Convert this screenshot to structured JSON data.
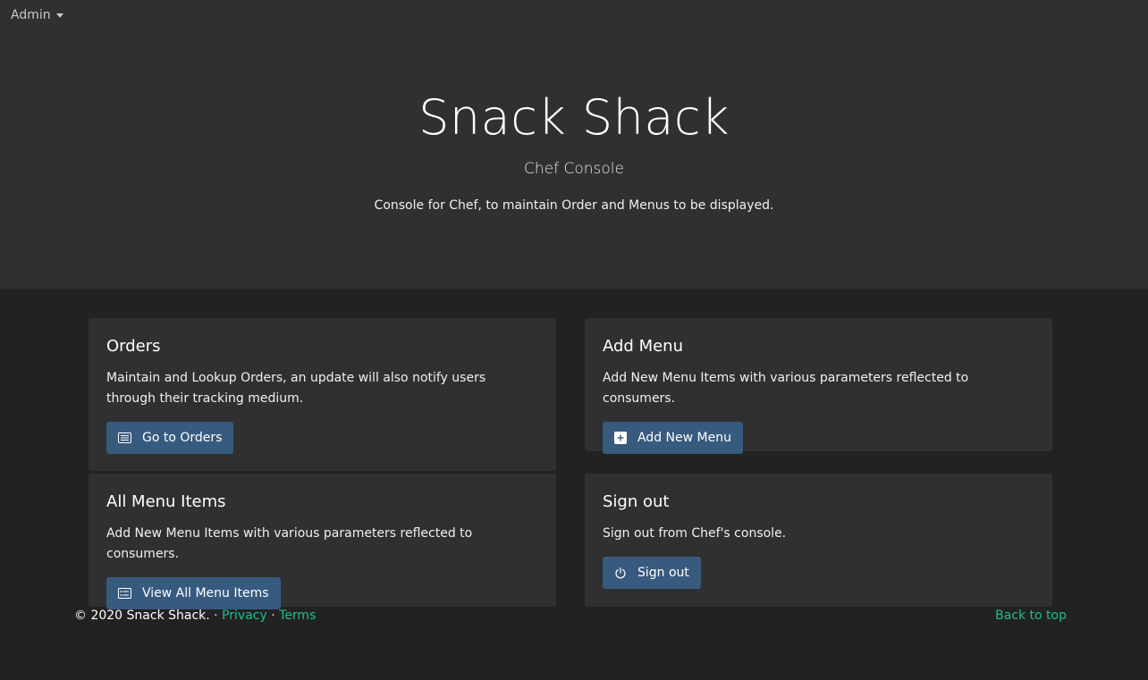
{
  "nav": {
    "admin_label": "Admin"
  },
  "hero": {
    "title": "Snack Shack",
    "subtitle": "Chef Console",
    "description": "Console for Chef, to maintain Order and Menus to be displayed."
  },
  "cards": {
    "orders": {
      "title": "Orders",
      "text": "Maintain and Lookup Orders, an update will also notify users through their tracking medium.",
      "button": "Go to Orders",
      "icon": "list-icon"
    },
    "add_menu": {
      "title": "Add Menu",
      "text": "Add New Menu Items with various parameters reflected to consumers.",
      "button": "Add New Menu",
      "icon": "plus-square-icon"
    },
    "all_menu_items": {
      "title": "All Menu Items",
      "text": "Add New Menu Items with various parameters reflected to consumers.",
      "button": "View All Menu Items",
      "icon": "card-list-icon"
    },
    "sign_out": {
      "title": "Sign out",
      "text": "Sign out from Chef's console.",
      "button": "Sign out",
      "icon": "power-icon"
    }
  },
  "footer": {
    "copyright": "© 2020 Snack Shack.",
    "separator": "·",
    "privacy": "Privacy",
    "terms": "Terms",
    "back_to_top": "Back to top"
  },
  "colors": {
    "hero_bg": "#303030",
    "page_bg": "#222222",
    "card_bg": "#303030",
    "button_bg": "#375a7f",
    "link": "#1dbf8f"
  }
}
